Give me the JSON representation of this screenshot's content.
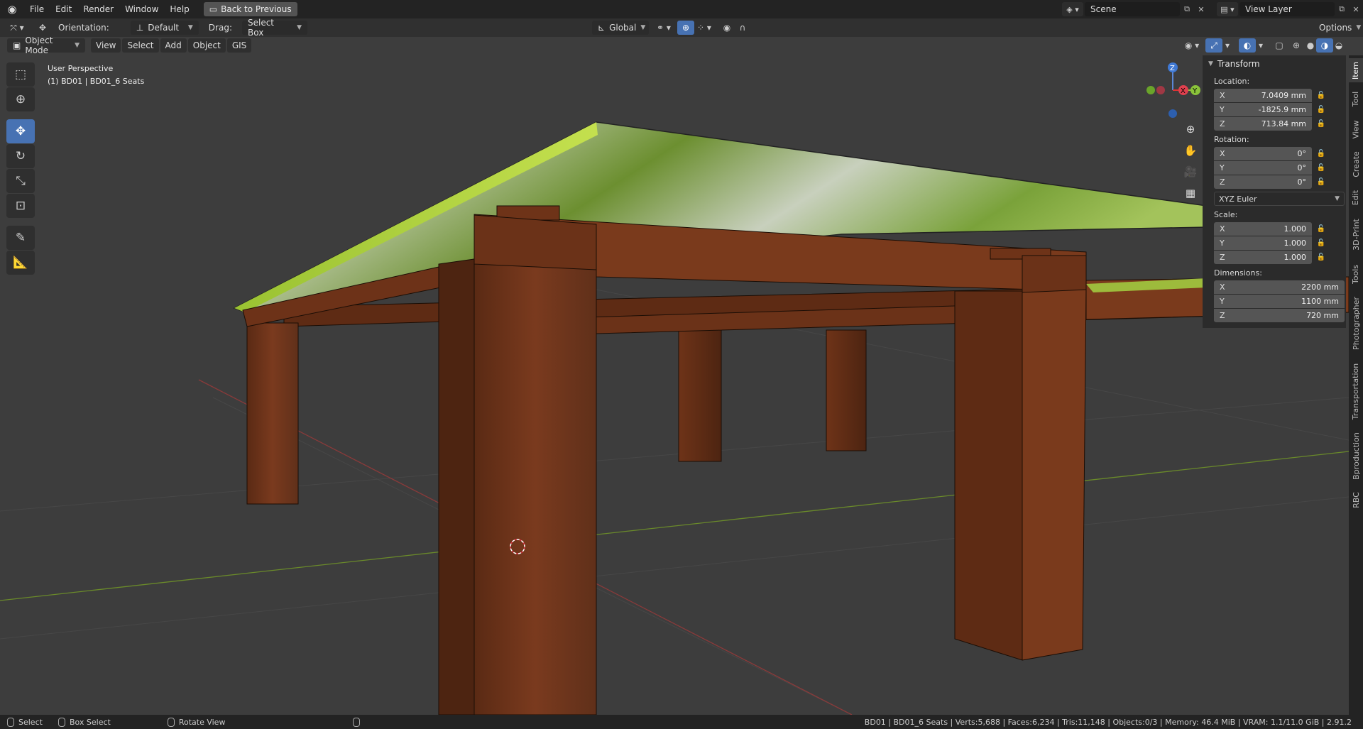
{
  "menubar": {
    "logo_icon": "blender-logo-icon",
    "items": [
      "File",
      "Edit",
      "Render",
      "Window",
      "Help"
    ],
    "back_button": "Back to Previous",
    "scene": "Scene",
    "view_layer": "View Layer"
  },
  "toolheader": {
    "orientation_label": "Orientation:",
    "orientation_value": "Default",
    "drag_label": "Drag:",
    "drag_value": "Select Box",
    "transform_orientation": "Global",
    "options": "Options"
  },
  "viewport_header": {
    "mode": "Object Mode",
    "menus": [
      "View",
      "Select",
      "Add",
      "Object",
      "GIS"
    ]
  },
  "viewport": {
    "perspective": "User Perspective",
    "object_info": "(1) BD01 | BD01_6 Seats"
  },
  "gizmo": {
    "z": "Z",
    "y": "Y",
    "x": "X"
  },
  "npanel": {
    "title": "Transform",
    "location_label": "Location:",
    "location": [
      {
        "axis": "X",
        "value": "7.0409 mm"
      },
      {
        "axis": "Y",
        "value": "-1825.9 mm"
      },
      {
        "axis": "Z",
        "value": "713.84 mm"
      }
    ],
    "rotation_label": "Rotation:",
    "rotation": [
      {
        "axis": "X",
        "value": "0°"
      },
      {
        "axis": "Y",
        "value": "0°"
      },
      {
        "axis": "Z",
        "value": "0°"
      }
    ],
    "rotation_mode": "XYZ Euler",
    "scale_label": "Scale:",
    "scale": [
      {
        "axis": "X",
        "value": "1.000"
      },
      {
        "axis": "Y",
        "value": "1.000"
      },
      {
        "axis": "Z",
        "value": "1.000"
      }
    ],
    "dimensions_label": "Dimensions:",
    "dimensions": [
      {
        "axis": "X",
        "value": "2200 mm"
      },
      {
        "axis": "Y",
        "value": "1100 mm"
      },
      {
        "axis": "Z",
        "value": "720 mm"
      }
    ]
  },
  "vtabs": [
    "Item",
    "Tool",
    "View",
    "Create",
    "Edit",
    "3D-Print",
    "Tools",
    "Photographer",
    "Transportation",
    "Bproduction",
    "RBC"
  ],
  "statusbar": {
    "select": "Select",
    "box_select": "Box Select",
    "rotate_view": "Rotate View",
    "stats": "BD01 | BD01_6 Seats | Verts:5,688 | Faces:6,234 | Tris:11,148 | Objects:0/3 | Memory: 46.4 MiB | VRAM: 1.1/11.0 GiB | 2.91.2"
  }
}
